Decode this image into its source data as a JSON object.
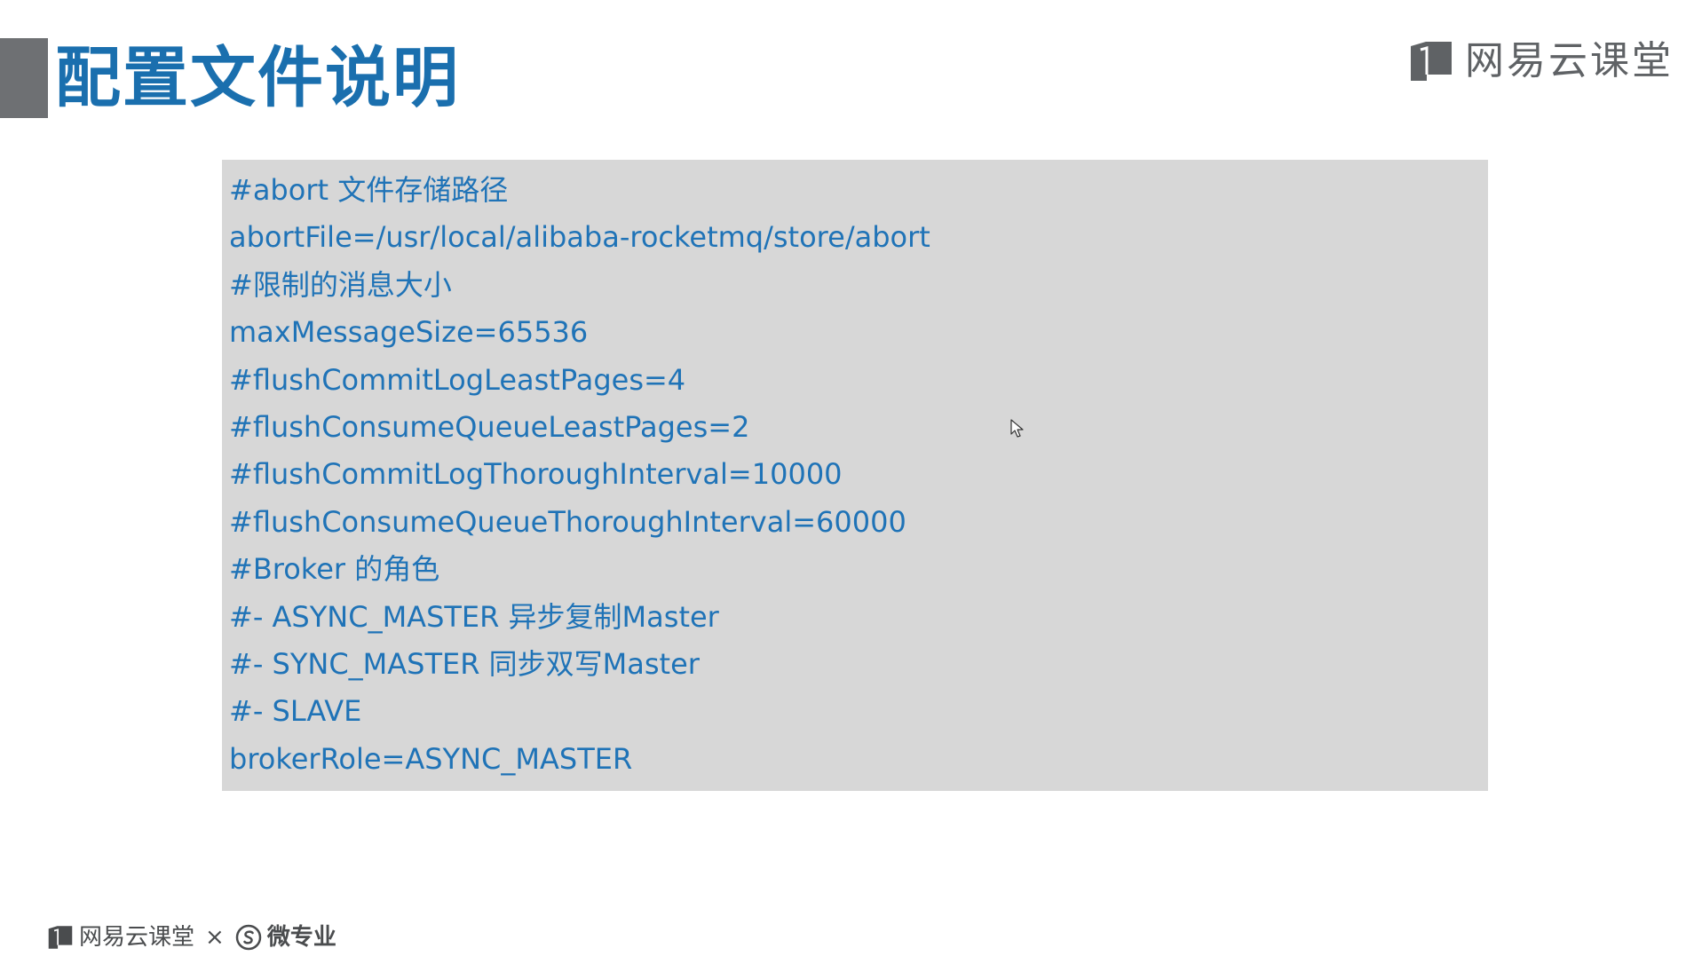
{
  "slide": {
    "title": "配置文件说明"
  },
  "brand_top": {
    "icon": "book-logo-icon",
    "text": "网易云课堂"
  },
  "code": {
    "lines": [
      "#abort 文件存储路径",
      "abortFile=/usr/local/alibaba-rocketmq/store/abort",
      "#限制的消息大小",
      "maxMessageSize=65536",
      "#flushCommitLogLeastPages=4",
      "#flushConsumeQueueLeastPages=2",
      "#flushCommitLogThoroughInterval=10000",
      "#flushConsumeQueueThoroughInterval=60000",
      "#Broker 的角色",
      "#- ASYNC_MASTER 异步复制Master",
      "#- SYNC_MASTER 同步双写Master",
      "#- SLAVE",
      "brokerRole=ASYNC_MASTER"
    ]
  },
  "brand_bottom": {
    "left_icon": "book-logo-icon",
    "left_text": "网易云课堂",
    "separator": "×",
    "right_icon": "s-circle-logo-icon",
    "right_text": "微专业"
  },
  "colors": {
    "title": "#1a6fae",
    "code_text": "#1f73b7",
    "code_background": "#d7d7d7",
    "title_bar": "#6e7073",
    "brand": "#5f6265"
  }
}
